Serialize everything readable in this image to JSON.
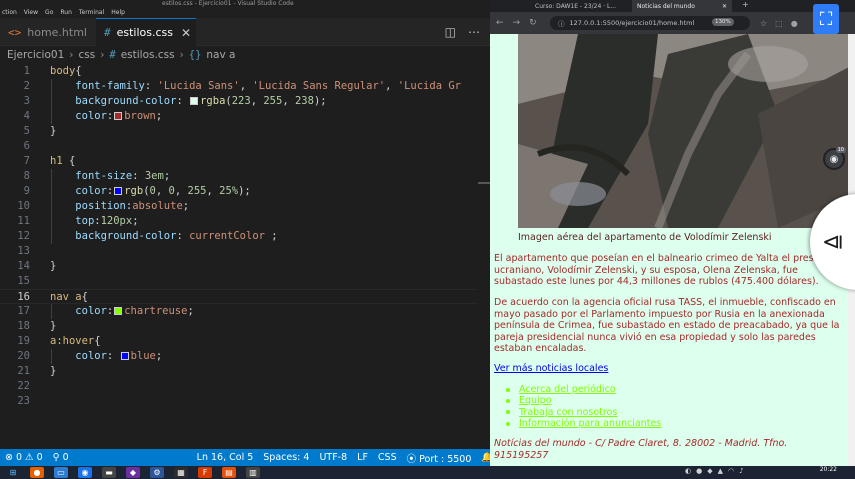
{
  "vscode": {
    "title_bar": {
      "menu": [
        "ction",
        "View",
        "Go",
        "Run",
        "Terminal",
        "Help"
      ],
      "title": "estilos.css - Ejercicio01 - Visual Studio Code"
    },
    "tabs": [
      {
        "icon": "<>",
        "label": "home.html",
        "close": ""
      },
      {
        "icon": "#",
        "label": "estilos.css",
        "close": "✕"
      }
    ],
    "tab_actions": {
      "split": "◫",
      "more": "⋯"
    },
    "breadcrumb": [
      "Ejercicio01",
      "css",
      "estilos.css",
      "nav a"
    ],
    "active_line": 16,
    "lines": [
      {
        "n": "1",
        "parts": [
          [
            "sel",
            "body"
          ],
          [
            "pun",
            "{"
          ]
        ]
      },
      {
        "n": "2",
        "parts": [
          [
            "pun",
            "    "
          ],
          [
            "prop",
            "font-family"
          ],
          [
            "pun",
            ": "
          ],
          [
            "str",
            "'Lucida Sans'"
          ],
          [
            "pun",
            ", "
          ],
          [
            "str",
            "'Lucida Sans Regular'"
          ],
          [
            "pun",
            ", "
          ],
          [
            "str",
            "'Lucida Gr"
          ]
        ]
      },
      {
        "n": "3",
        "parts": [
          [
            "pun",
            "    "
          ],
          [
            "prop",
            "background-color"
          ],
          [
            "pun",
            ": "
          ],
          [
            "swatch",
            "#dfffee"
          ],
          [
            "fn",
            "rgba"
          ],
          [
            "pun",
            "("
          ],
          [
            "num",
            "223"
          ],
          [
            "pun",
            ", "
          ],
          [
            "num",
            "255"
          ],
          [
            "pun",
            ", "
          ],
          [
            "num",
            "238"
          ],
          [
            "pun",
            ");"
          ]
        ]
      },
      {
        "n": "4",
        "parts": [
          [
            "pun",
            "    "
          ],
          [
            "prop",
            "color"
          ],
          [
            "pun",
            ":"
          ],
          [
            "swatch",
            "#a52a2a"
          ],
          [
            "val",
            "brown"
          ],
          [
            "pun",
            ";"
          ]
        ]
      },
      {
        "n": "5",
        "parts": [
          [
            "pun",
            "}"
          ]
        ]
      },
      {
        "n": "6",
        "parts": []
      },
      {
        "n": "7",
        "parts": [
          [
            "sel",
            "h1"
          ],
          [
            "pun",
            " {"
          ]
        ]
      },
      {
        "n": "8",
        "parts": [
          [
            "pun",
            "    "
          ],
          [
            "prop",
            "font-size"
          ],
          [
            "pun",
            ": "
          ],
          [
            "num",
            "3em"
          ],
          [
            "pun",
            ";"
          ]
        ]
      },
      {
        "n": "9",
        "parts": [
          [
            "pun",
            "    "
          ],
          [
            "prop",
            "color"
          ],
          [
            "pun",
            ":"
          ],
          [
            "swatch",
            "#0000ff"
          ],
          [
            "fn",
            "rgb"
          ],
          [
            "pun",
            "("
          ],
          [
            "num",
            "0"
          ],
          [
            "pun",
            ", "
          ],
          [
            "num",
            "0"
          ],
          [
            "pun",
            ", "
          ],
          [
            "num",
            "255"
          ],
          [
            "pun",
            ", "
          ],
          [
            "num",
            "25%"
          ],
          [
            "pun",
            ");"
          ]
        ]
      },
      {
        "n": "10",
        "parts": [
          [
            "pun",
            "    "
          ],
          [
            "prop",
            "position"
          ],
          [
            "pun",
            ":"
          ],
          [
            "val",
            "absolute"
          ],
          [
            "pun",
            ";"
          ]
        ]
      },
      {
        "n": "11",
        "parts": [
          [
            "pun",
            "    "
          ],
          [
            "prop",
            "top"
          ],
          [
            "pun",
            ":"
          ],
          [
            "num",
            "120px"
          ],
          [
            "pun",
            ";"
          ]
        ]
      },
      {
        "n": "12",
        "parts": [
          [
            "pun",
            "    "
          ],
          [
            "prop",
            "background-color"
          ],
          [
            "pun",
            ": "
          ],
          [
            "val",
            "currentColor"
          ],
          [
            "pun",
            " ;"
          ]
        ]
      },
      {
        "n": "13",
        "parts": []
      },
      {
        "n": "14",
        "parts": [
          [
            "pun",
            "}"
          ]
        ]
      },
      {
        "n": "15",
        "parts": []
      },
      {
        "n": "16",
        "parts": [
          [
            "sel",
            "nav a"
          ],
          [
            "pun",
            "{"
          ]
        ]
      },
      {
        "n": "17",
        "parts": [
          [
            "pun",
            "    "
          ],
          [
            "prop",
            "color"
          ],
          [
            "pun",
            ":"
          ],
          [
            "swatch",
            "#7fff00"
          ],
          [
            "val",
            "chartreuse"
          ],
          [
            "pun",
            ";"
          ]
        ]
      },
      {
        "n": "18",
        "parts": [
          [
            "pun",
            "}"
          ]
        ]
      },
      {
        "n": "19",
        "parts": [
          [
            "sel",
            "a:hover"
          ],
          [
            "pun",
            "{"
          ]
        ]
      },
      {
        "n": "20",
        "parts": [
          [
            "pun",
            "    "
          ],
          [
            "prop",
            "color"
          ],
          [
            "pun",
            ": "
          ],
          [
            "swatch",
            "#0000ff"
          ],
          [
            "val",
            "blue"
          ],
          [
            "pun",
            ";"
          ]
        ]
      },
      {
        "n": "21",
        "parts": [
          [
            "pun",
            "}"
          ]
        ]
      },
      {
        "n": "22",
        "parts": []
      },
      {
        "n": "23",
        "parts": []
      }
    ],
    "status": {
      "errors": "⊗ 0  ⚠ 0",
      "ports": "⚲ 0",
      "position": "Ln 16, Col 5",
      "spaces": "Spaces: 4",
      "encoding": "UTF-8",
      "eol": "LF",
      "language": "CSS",
      "port": "⦿ Port : 5500",
      "bell": "🔔"
    }
  },
  "browser": {
    "tabs": [
      {
        "label": "Curso: DAW1E - 23/24 · L...",
        "close": "✕"
      },
      {
        "label": "Noticias del mundo",
        "close": "✕"
      }
    ],
    "new_tab": "+",
    "url": "127.0.0.1:5500/ejercicio01/home.html",
    "zoom": "130%",
    "fullscreen_icon": "⛶",
    "avatar_badge": "10",
    "page": {
      "caption": "Imagen aérea del apartamento de Volodímir Zelenski",
      "paragraphs": [
        "El apartamento que poseían en el balneario crimeo de Yalta el presidente ucraniano, Volodímir Zelenski, y su esposa, Olena Zelenska, fue subastado este lunes por 44,3 millones de rublos (475.400 dólares).",
        "De acuerdo con la agencia oficial rusa TASS, el inmueble, confiscado en mayo pasado por el Parlamento impuesto por Rusia en la anexionada península de Crimea, fue subastado en estado de preacabado, ya que la pareja presidencial nunca vivió en esa propiedad y solo las paredes estaban encaladas."
      ],
      "more_link": "Ver más noticias locales",
      "nav_links": [
        "Acerca del periódico",
        "Equipo",
        "Trabaja con nosotros",
        "Información para anunciantes"
      ],
      "footer": "Notícias del mundo - C/ Padre Claret, 8. 28002 - Madrid. Tfno. 915195257"
    }
  },
  "taskbar": {
    "time": "20:22",
    "date": "—"
  }
}
